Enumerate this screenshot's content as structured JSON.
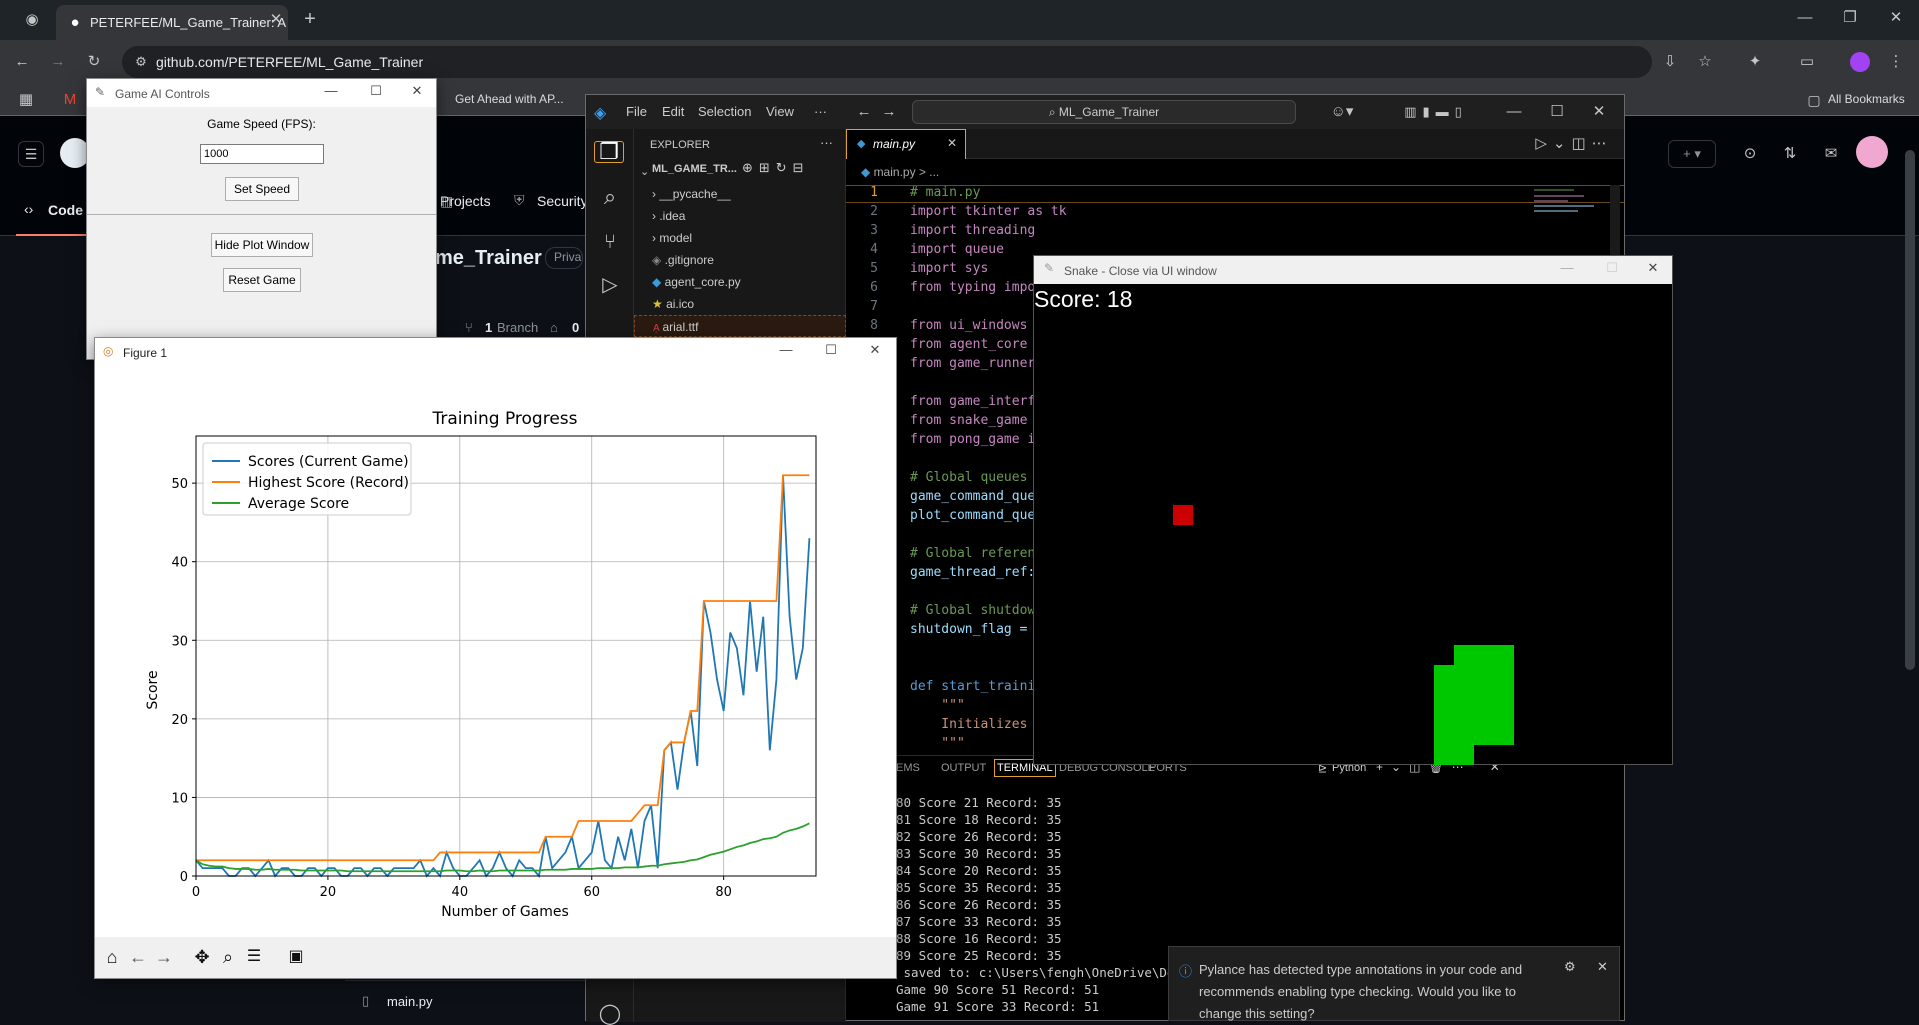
{
  "browser": {
    "tab_title": "PETERFEE/ML_Game_Trainer: A",
    "url": "github.com/PETERFEE/ML_Game_Trainer",
    "bookmark_promo": "Get Ahead with AP...",
    "all_bookmarks": "All Bookmarks"
  },
  "github": {
    "nav_code": "Code",
    "nav_projects": "Projects",
    "nav_security": "Security",
    "repo_name_partial": "me_Trainer",
    "visibility": "Private",
    "branch_count": "1",
    "branch_label": "Branch",
    "tags_count": "0",
    "file_main": "main.py"
  },
  "controls_window": {
    "title": "Game AI Controls",
    "speed_label": "Game Speed (FPS):",
    "speed_value": "1000",
    "set_speed": "Set Speed",
    "hide_plot": "Hide Plot Window",
    "reset_game": "Reset Game"
  },
  "vscode": {
    "menu": [
      "File",
      "Edit",
      "Selection",
      "View",
      "···"
    ],
    "search": "ML_Game_Trainer",
    "explorer_title": "EXPLORER",
    "project_root": "ML_GAME_TR...",
    "files": [
      "__pycache__",
      ".idea",
      "model",
      ".gitignore",
      "agent_core.py",
      "ai.ico",
      "arial.ttf"
    ],
    "active_tab": "main.py",
    "breadcrumb": "main.py > ...",
    "code_lines": [
      "# main.py",
      "import tkinter as tk",
      "import threading",
      "import queue",
      "import sys",
      "from typing impo",
      "",
      "from ui_windows",
      "from agent_core",
      "from game_runner",
      "",
      "from game_interf",
      "from snake_game",
      "from pong_game i",
      "",
      "# Global queues",
      "game_command_que",
      "plot_command_que",
      "",
      "# Global referen",
      "game_thread_ref:",
      "",
      "# Global shutdow",
      "shutdown_flag =",
      "",
      "",
      "def start_traini",
      "    \"\"\"",
      "    Initializes",
      "    \"\"\""
    ],
    "panel_tabs": [
      "EMS",
      "OUTPUT",
      "TERMINAL",
      "DEBUG CONSOLE",
      "PORTS"
    ],
    "terminal_profile": "Python",
    "terminal_lines": [
      "80 Score 21 Record: 35",
      "81 Score 18 Record: 35",
      "82 Score 26 Record: 35",
      "83 Score 30 Record: 35",
      "84 Score 20 Record: 35",
      "85 Score 35 Record: 35",
      "86 Score 26 Record: 35",
      "87 Score 33 Record: 35",
      "88 Score 16 Record: 35",
      "89 Score 25 Record: 35",
      " saved to: c:\\Users\\fengh\\OneDrive\\Docu",
      "Game 90 Score 51 Record: 51",
      "Game 91 Score 33 Record: 51"
    ],
    "toast_text": "Pylance has detected type annotations in your code and recommends enabling type checking. Would you like to change this setting?"
  },
  "snake_window": {
    "title": "Snake - Close via UI window",
    "score_text": "Score: 18",
    "food_color": "#cc0000",
    "snake_color": "#00c800"
  },
  "plot_window": {
    "title": "Figure 1"
  },
  "chart_data": {
    "type": "line",
    "title": "Training Progress",
    "xlabel": "Number of Games",
    "ylabel": "Score",
    "xlim": [
      0,
      94
    ],
    "ylim": [
      0,
      56
    ],
    "xticks": [
      0,
      20,
      40,
      60,
      80
    ],
    "yticks": [
      0,
      10,
      20,
      30,
      40,
      50
    ],
    "grid": true,
    "legend_position": "top-left",
    "series": [
      {
        "name": "Scores (Current Game)",
        "color": "#1f77b4",
        "values": [
          2,
          1,
          1,
          1,
          1,
          0,
          0,
          1,
          1,
          0,
          1,
          2,
          0,
          1,
          1,
          0,
          0,
          1,
          1,
          0,
          1,
          1,
          0,
          0,
          1,
          1,
          0,
          1,
          1,
          0,
          1,
          1,
          1,
          1,
          2,
          0,
          1,
          0,
          3,
          1,
          0,
          0,
          1,
          2,
          0,
          1,
          3,
          1,
          0,
          2,
          1,
          1,
          0,
          5,
          1,
          2,
          3,
          5,
          1,
          2,
          3,
          7,
          2,
          1,
          5,
          2,
          6,
          1,
          7,
          9,
          1,
          16,
          17,
          11,
          17,
          21,
          14,
          35,
          31,
          25,
          21,
          31,
          29,
          23,
          35,
          26,
          33,
          16,
          25,
          51,
          33,
          25,
          29,
          43
        ]
      },
      {
        "name": "Highest Score (Record)",
        "color": "#ff7f0e",
        "values": [
          2,
          2,
          2,
          2,
          2,
          2,
          2,
          2,
          2,
          2,
          2,
          2,
          2,
          2,
          2,
          2,
          2,
          2,
          2,
          2,
          2,
          2,
          2,
          2,
          2,
          2,
          2,
          2,
          2,
          2,
          2,
          2,
          2,
          2,
          2,
          2,
          2,
          3,
          3,
          3,
          3,
          3,
          3,
          3,
          3,
          3,
          3,
          3,
          3,
          3,
          3,
          3,
          3,
          5,
          5,
          5,
          5,
          5,
          7,
          7,
          7,
          7,
          7,
          7,
          7,
          7,
          7,
          8,
          9,
          9,
          9,
          16,
          17,
          17,
          17,
          21,
          21,
          35,
          35,
          35,
          35,
          35,
          35,
          35,
          35,
          35,
          35,
          35,
          35,
          51,
          51,
          51,
          51,
          51
        ]
      },
      {
        "name": "Average Score",
        "color": "#2ca02c",
        "values": [
          2,
          1.5,
          1.3,
          1.2,
          1.2,
          1,
          0.9,
          0.9,
          0.9,
          0.8,
          0.8,
          0.9,
          0.8,
          0.8,
          0.8,
          0.8,
          0.7,
          0.7,
          0.7,
          0.7,
          0.7,
          0.7,
          0.7,
          0.6,
          0.6,
          0.6,
          0.6,
          0.6,
          0.6,
          0.6,
          0.6,
          0.6,
          0.6,
          0.6,
          0.6,
          0.6,
          0.6,
          0.6,
          0.7,
          0.7,
          0.7,
          0.6,
          0.6,
          0.7,
          0.6,
          0.6,
          0.7,
          0.7,
          0.7,
          0.7,
          0.7,
          0.7,
          0.7,
          0.8,
          0.8,
          0.8,
          0.8,
          0.9,
          0.9,
          0.9,
          0.9,
          1,
          1,
          1,
          1,
          1.1,
          1.1,
          1.1,
          1.2,
          1.3,
          1.3,
          1.5,
          1.6,
          1.7,
          1.8,
          2,
          2.1,
          2.4,
          2.7,
          2.9,
          3.1,
          3.4,
          3.7,
          3.9,
          4.2,
          4.4,
          4.7,
          4.8,
          5,
          5.5,
          5.8,
          6,
          6.3,
          6.7
        ]
      }
    ]
  }
}
